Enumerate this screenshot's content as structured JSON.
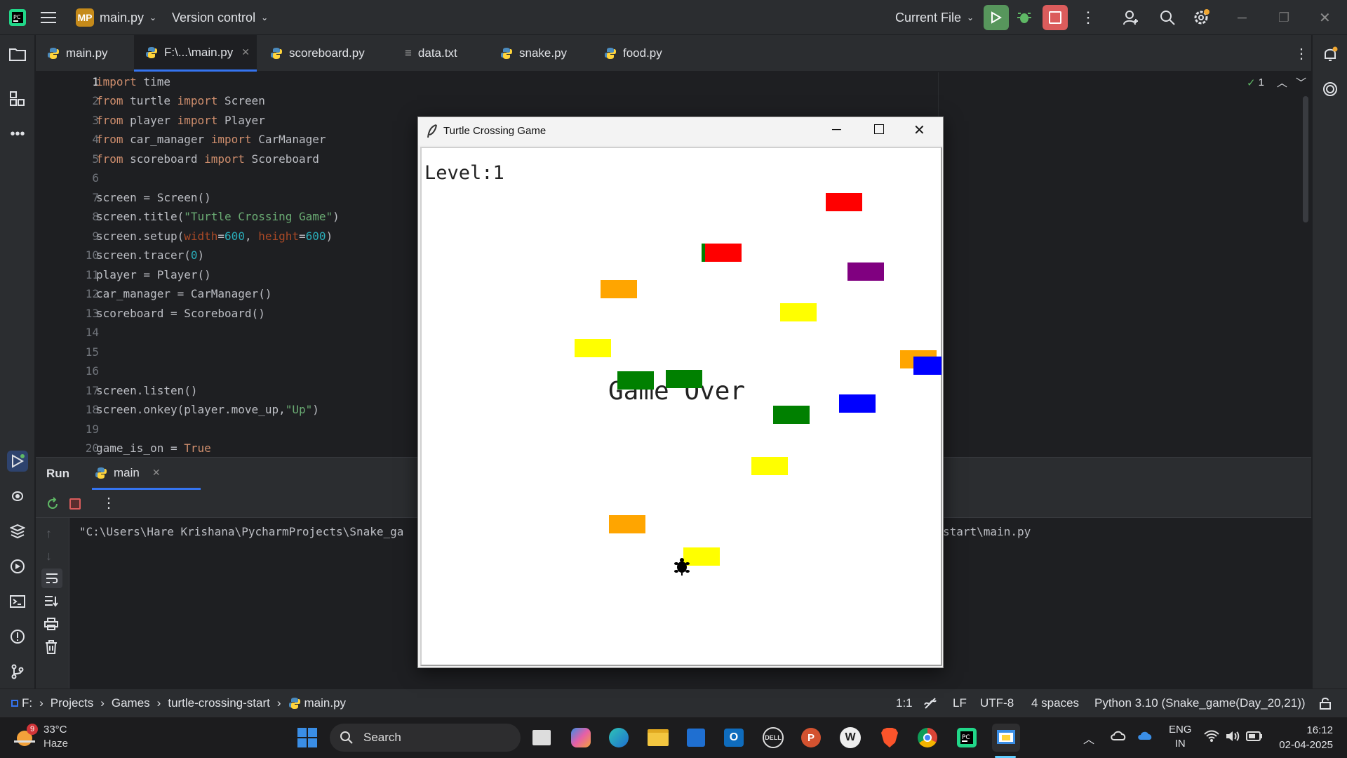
{
  "titlebar": {
    "project_badge": "MP",
    "project_name": "main.py",
    "vcs_label": "Version control",
    "run_config": "Current File"
  },
  "tabs": [
    {
      "label": "main.py"
    },
    {
      "label": "F:\\...\\main.py"
    },
    {
      "label": "scoreboard.py"
    },
    {
      "label": "data.txt"
    },
    {
      "label": "snake.py"
    },
    {
      "label": "food.py"
    }
  ],
  "editor": {
    "inspection_count": "1",
    "line_numbers": [
      "1",
      "2",
      "3",
      "4",
      "5",
      "6",
      "7",
      "8",
      "9",
      "10",
      "11",
      "12",
      "13",
      "14",
      "15",
      "16",
      "17",
      "18",
      "19",
      "20"
    ]
  },
  "run_panel": {
    "run_label": "Run",
    "tab_label": "main",
    "console_left": "\"C:\\Users\\Hare Krishana\\PycharmProjects\\Snake_ga",
    "console_right": "start\\main.py"
  },
  "game_window": {
    "title": "Turtle Crossing Game",
    "level_text": "Level:1",
    "game_over_text": "Game Over"
  },
  "breadcrumb": {
    "drive": "F:",
    "items": [
      "Projects",
      "Games",
      "turtle-crossing-start",
      "main.py"
    ]
  },
  "statusbar": {
    "position": "1:1",
    "line_sep": "LF",
    "encoding": "UTF-8",
    "indent": "4 spaces",
    "interpreter": "Python 3.10 (Snake_game(Day_20,21))"
  },
  "taskbar": {
    "weather_temp": "33°C",
    "weather_desc": "Haze",
    "weather_badge": "9",
    "search_placeholder": "Search",
    "lang_top": "ENG",
    "lang_bottom": "IN",
    "time": "16:12",
    "date": "02-04-2025"
  },
  "colors": {
    "car_red": "#ff0000",
    "car_green": "#008000",
    "car_orange": "#ffa500",
    "car_yellow": "#ffff00",
    "car_purple": "#800080",
    "car_blue": "#0000ff"
  }
}
